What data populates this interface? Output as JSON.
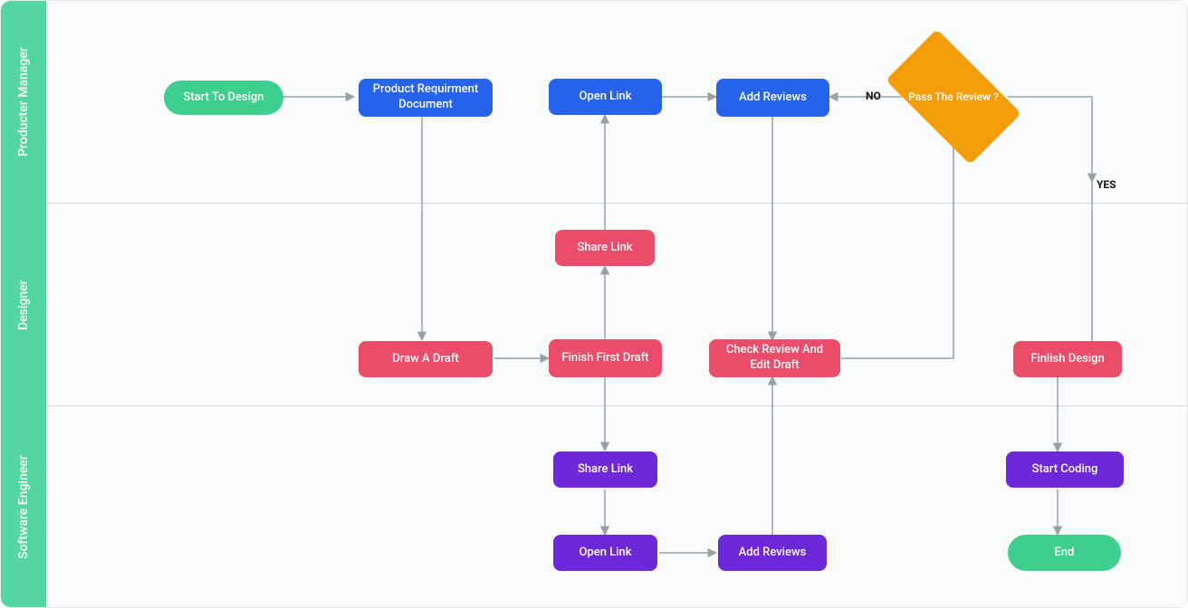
{
  "lanes": {
    "pm": "Producter Manager",
    "designer": "Designer",
    "se": "Software Engineer"
  },
  "nodes": {
    "start": "Start To Design",
    "prd": "Product Requirment Document",
    "open_link_pm": "Open Link",
    "add_reviews_pm": "Add Reviews",
    "decision": "Pass The Review ?",
    "decision_no": "NO",
    "decision_yes": "YES",
    "share_link_d": "Share Link",
    "draw_draft": "Draw A Draft",
    "finish_first": "Finish First Draft",
    "check_review": "Check Review And Edit Draft",
    "finish_design": "Finlish Design",
    "share_link_se": "Share Link",
    "open_link_se": "Open Link",
    "add_reviews_se": "Add Reviews",
    "start_coding": "Start Coding",
    "end": "End"
  }
}
